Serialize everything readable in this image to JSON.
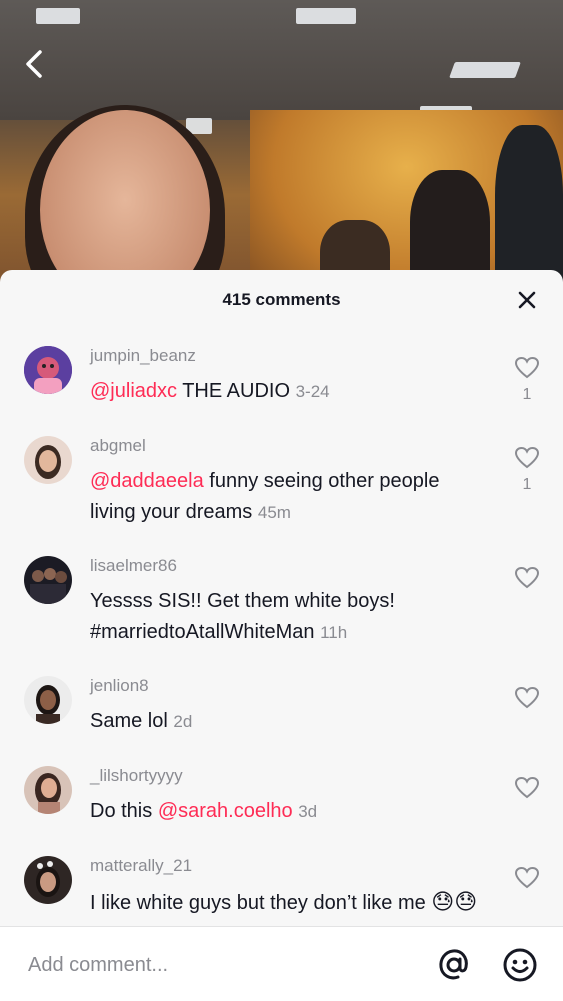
{
  "sheet": {
    "title": "415 comments"
  },
  "comments": [
    {
      "username": "jumpin_beanz",
      "mention": "@juliadxc",
      "text": "THE AUDIO",
      "time": "3-24",
      "likes": "1",
      "avatar_color": "#5b3fa0"
    },
    {
      "username": "abgmel",
      "mention": "@daddaeela",
      "text": "funny seeing other people living your dreams",
      "time": "45m",
      "likes": "1",
      "avatar_color": "#d9b6a3"
    },
    {
      "username": "lisaelmer86",
      "mention": "",
      "text": "Yessss SIS!! Get them white boys! #marriedtoAtallWhiteMan",
      "time": "11h",
      "likes": "",
      "avatar_color": "#1b1b24"
    },
    {
      "username": "jenlion8",
      "mention": "",
      "text": "Same lol",
      "time": "2d",
      "likes": "",
      "avatar_color": "#e8e6e6"
    },
    {
      "username": "_lilshortyyyy",
      "mention": "",
      "text": "Do this",
      "mention_after": "@sarah.coelho",
      "time": "3d",
      "likes": "",
      "avatar_color": "#c99b86"
    },
    {
      "username": "matterally_21",
      "mention": "",
      "text": "I like white guys but they don’t like me",
      "time": "",
      "likes": "",
      "avatar_color": "#3a2f2c"
    }
  ],
  "input": {
    "placeholder": "Add comment..."
  },
  "colors": {
    "accent_mention": "#fe2c55",
    "secondary_text": "#8a8b91",
    "primary_text": "#161823"
  }
}
